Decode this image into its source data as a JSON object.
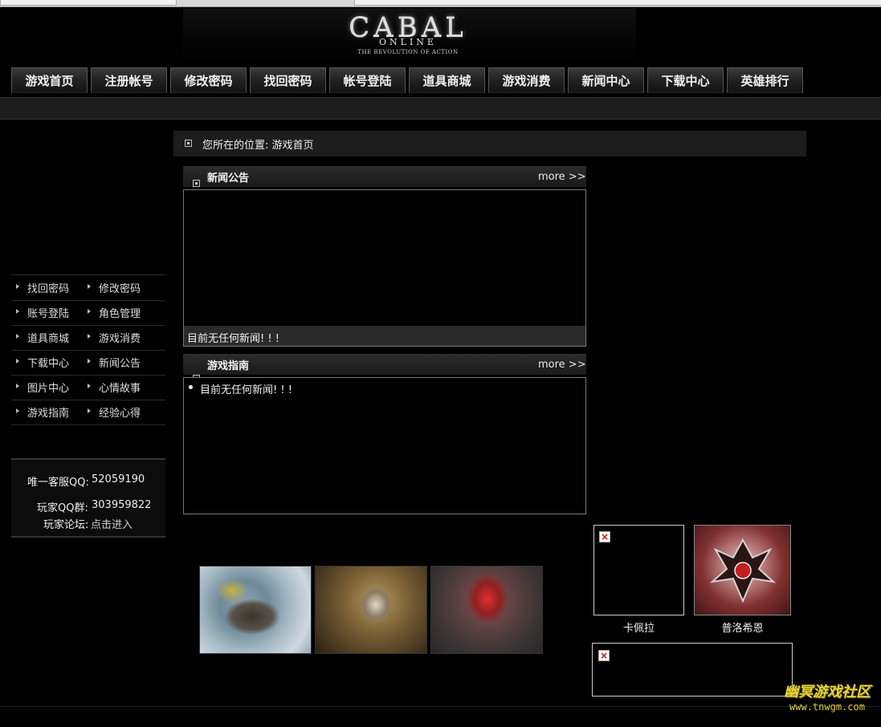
{
  "logo": {
    "title": "CABAL",
    "subtitle": "ONLINE",
    "tagline": "THE REVOLUTION OF ACTION"
  },
  "nav": {
    "items": [
      "游戏首页",
      "注册帐号",
      "修改密码",
      "找回密码",
      "帐号登陆",
      "道具商城",
      "游戏消费",
      "新闻中心",
      "下载中心",
      "英雄排行"
    ]
  },
  "location": {
    "label": "您所在的位置: 游戏首页"
  },
  "news_panel": {
    "title": "新闻公告",
    "more": "more >>",
    "empty_text": "目前无任何新闻! ! !"
  },
  "guide_panel": {
    "title": "游戏指南",
    "more": "more >>",
    "empty_text": "目前无任何新闻! ! !"
  },
  "side_menu": {
    "rows": [
      [
        "找回密码",
        "修改密码"
      ],
      [
        "账号登陆",
        "角色管理"
      ],
      [
        "道具商城",
        "游戏消费"
      ],
      [
        "下载中心",
        "新闻公告"
      ],
      [
        "图片中心",
        "心情故事"
      ],
      [
        "游戏指南",
        "经验心得"
      ]
    ]
  },
  "contact": {
    "qq_label": "唯一客服QQ:",
    "qq_value": "52059190",
    "group_label": "玩家QQ群:",
    "group_value": "303959822",
    "forum_label": "玩家论坛:",
    "forum_link": "点击进入"
  },
  "characters": {
    "left_name": "卡佩拉",
    "right_name": "普洛希恩"
  },
  "watermark": {
    "title": "幽冥游戏社区",
    "url": "www.tnwgm.com"
  }
}
